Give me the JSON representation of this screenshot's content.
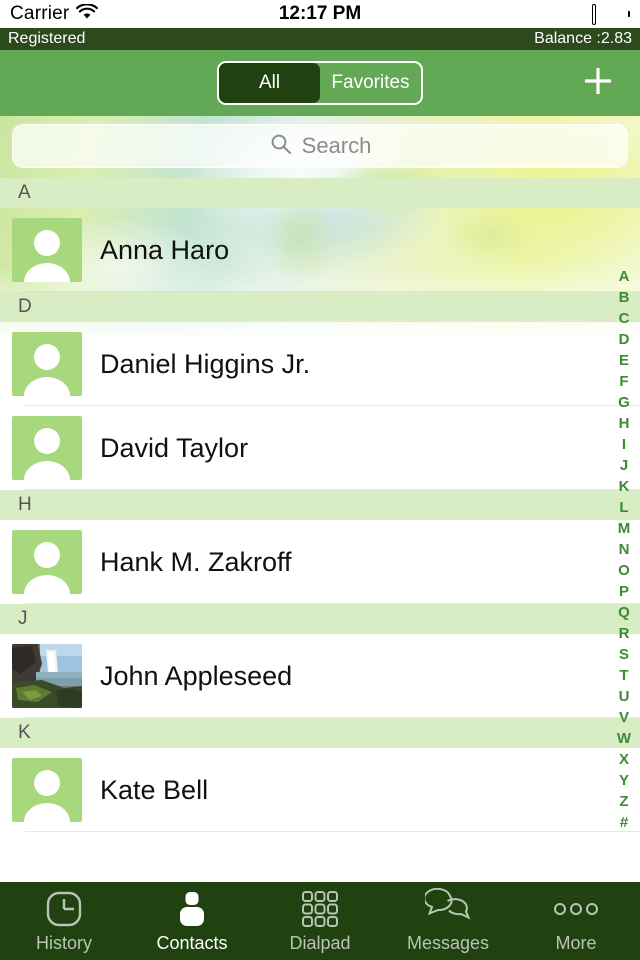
{
  "statusbar": {
    "carrier": "Carrier",
    "wifi_icon": "wifi-icon",
    "time": "12:17 PM",
    "battery_icon": "battery-full-icon"
  },
  "regbar": {
    "status": "Registered",
    "balance": "Balance :2.83"
  },
  "navbar": {
    "segments": [
      {
        "label": "All",
        "active": true
      },
      {
        "label": "Favorites",
        "active": false
      }
    ],
    "add_icon": "plus-icon",
    "background_color": "#63a854"
  },
  "search": {
    "placeholder": "Search",
    "icon": "search-icon"
  },
  "list": {
    "sections": [
      {
        "letter": "A",
        "contacts": [
          {
            "name": "Anna Haro",
            "avatar": "person-placeholder-icon"
          }
        ]
      },
      {
        "letter": "D",
        "contacts": [
          {
            "name": "Daniel Higgins Jr.",
            "avatar": "person-placeholder-icon"
          },
          {
            "name": "David Taylor",
            "avatar": "person-placeholder-icon"
          }
        ]
      },
      {
        "letter": "H",
        "contacts": [
          {
            "name": "Hank M. Zakroff",
            "avatar": "person-placeholder-icon"
          }
        ]
      },
      {
        "letter": "J",
        "contacts": [
          {
            "name": "John Appleseed",
            "avatar": "photo-waterfall"
          }
        ]
      },
      {
        "letter": "K",
        "contacts": [
          {
            "name": "Kate Bell",
            "avatar": "person-placeholder-icon"
          }
        ]
      }
    ]
  },
  "index_bar": {
    "letters": [
      "A",
      "B",
      "C",
      "D",
      "E",
      "F",
      "G",
      "H",
      "I",
      "J",
      "K",
      "L",
      "M",
      "N",
      "O",
      "P",
      "Q",
      "R",
      "S",
      "T",
      "U",
      "V",
      "W",
      "X",
      "Y",
      "Z",
      "#"
    ],
    "color": "#3f8a35"
  },
  "tabbar": {
    "background_color": "#1f4210",
    "tabs": [
      {
        "label": "History",
        "icon": "clock-icon",
        "active": false
      },
      {
        "label": "Contacts",
        "icon": "person-icon",
        "active": true
      },
      {
        "label": "Dialpad",
        "icon": "keypad-icon",
        "active": false
      },
      {
        "label": "Messages",
        "icon": "chat-icon",
        "active": false
      },
      {
        "label": "More",
        "icon": "ellipsis-icon",
        "active": false
      }
    ]
  }
}
